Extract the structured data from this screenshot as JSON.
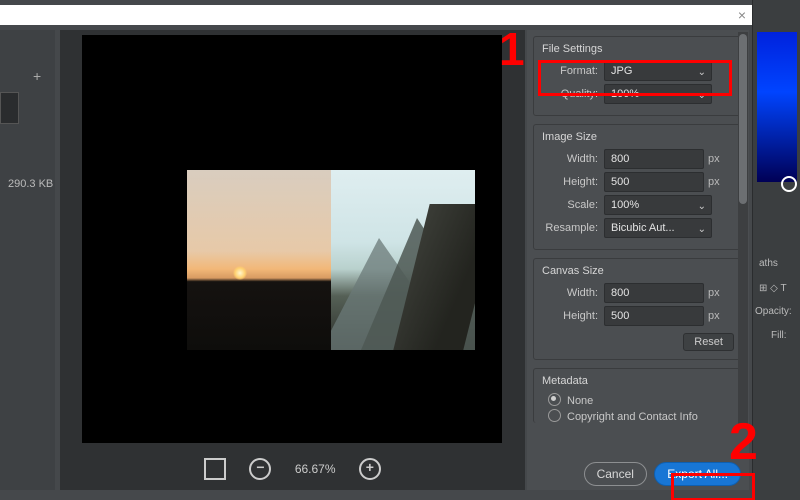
{
  "titlebar": {
    "close_glyph": "×"
  },
  "left": {
    "plus_glyph": "+",
    "filesize": "290.3 KB"
  },
  "zoom": {
    "level": "66.67%",
    "minus": "−",
    "plus": "+"
  },
  "settings": {
    "file": {
      "title": "File Settings",
      "format_label": "Format:",
      "format_value": "JPG",
      "quality_label": "Quality:",
      "quality_value": "100%"
    },
    "image": {
      "title": "Image Size",
      "width_label": "Width:",
      "width_value": "800",
      "height_label": "Height:",
      "height_value": "500",
      "scale_label": "Scale:",
      "scale_value": "100%",
      "resample_label": "Resample:",
      "resample_value": "Bicubic Aut...",
      "px": "px"
    },
    "canvas": {
      "title": "Canvas Size",
      "width_label": "Width:",
      "width_value": "800",
      "height_label": "Height:",
      "height_value": "500",
      "px": "px",
      "reset": "Reset"
    },
    "metadata": {
      "title": "Metadata",
      "none": "None",
      "contact": "Copyright and Contact Info"
    }
  },
  "footer": {
    "cancel": "Cancel",
    "export": "Export All..."
  },
  "chrome": {
    "paths": "aths",
    "opacity": "Opacity:",
    "fill": "Fill:"
  },
  "annotations": {
    "one": "1",
    "two": "2"
  }
}
